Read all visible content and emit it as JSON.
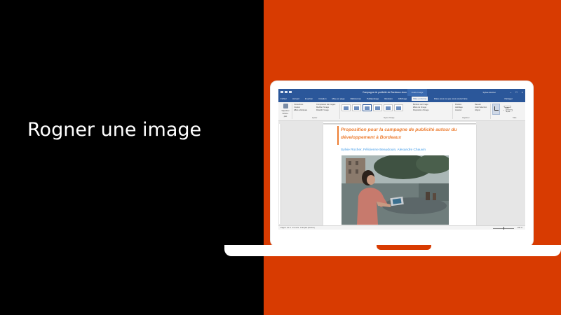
{
  "slide": {
    "title": "Rogner une image",
    "colors": {
      "left_bg": "#000000",
      "right_bg": "#d83b01",
      "laptop": "#ffffff"
    }
  },
  "word": {
    "window_title": "Campagne de publicité de Bordeaux.docx",
    "context_tools": "Outils Image",
    "user": "Sylvie Rocher",
    "share": "Partager",
    "tell_me": "Dites-nous ce que vous voulez faire",
    "tabs": [
      "Fichier",
      "Accueil",
      "Insertion",
      "Création",
      "Mise en page",
      "Références",
      "Publipostage",
      "Révision",
      "Affichage",
      "Mise en forme"
    ],
    "active_tab": "Mise en forme",
    "ribbon": {
      "remove_bg": "Supprimer l'arrière-plan",
      "adjust": [
        "Corrections",
        "Couleur",
        "Effets artistiques"
      ],
      "adjust2": [
        "Compresser les images",
        "Modifier l'image",
        "Rétablir l'image"
      ],
      "picture_options": [
        "Bordure de l'image",
        "Effets de l'image",
        "Disposition d'image"
      ],
      "arrange": [
        "Position",
        "Habillage",
        "Avancer"
      ],
      "arrange2": [
        "Reculer",
        "Volet Sélection",
        "Aligner"
      ],
      "crop": "Rogner",
      "height": "3,86\"",
      "width": "5,04\"",
      "group_labels": [
        "Ajuster",
        "Styles d'image",
        "Organiser",
        "Taille"
      ]
    },
    "document": {
      "heading": "Proposition pour la campagne de publicité autour du développement à Bordeaux",
      "authors": "Sylvie Rocher, Félicienne Beaudouin, Alexandre Chauvin"
    },
    "status": {
      "page": "Page 1 sur 3",
      "words": "31 mots",
      "language": "Français (France)",
      "zoom": "100 %"
    },
    "accent_colors": {
      "title_bar": "#2b579a",
      "heading": "#ed7d31",
      "authors": "#3d9ae8"
    }
  }
}
